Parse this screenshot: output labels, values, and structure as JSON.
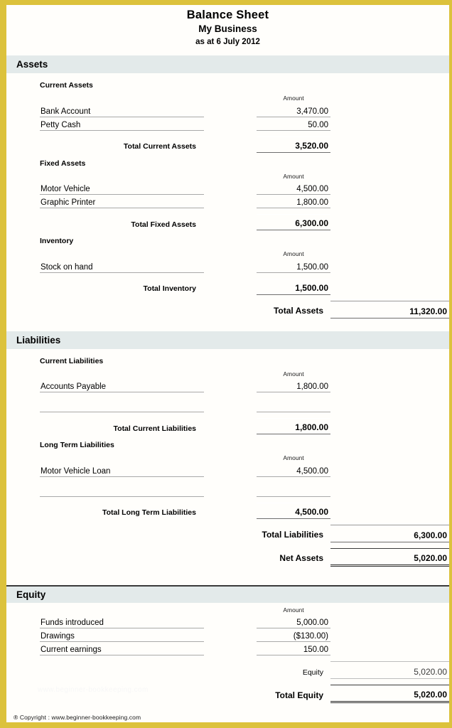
{
  "document": {
    "title": "Balance Sheet",
    "company": "My Business",
    "as_at": "as at 6 July 2012",
    "amount_header": "Amount",
    "accent_border_color": "#dcc23c",
    "section_bar_color": "#e3eaea"
  },
  "sections": {
    "assets": {
      "heading": "Assets",
      "groups": [
        {
          "title": "Current Assets",
          "items": [
            {
              "name": "Bank Account",
              "amount": "3,470.00"
            },
            {
              "name": "Petty Cash",
              "amount": "50.00"
            }
          ],
          "total_label": "Total Current Assets",
          "total_amount": "3,520.00"
        },
        {
          "title": "Fixed Assets",
          "items": [
            {
              "name": "Motor Vehicle",
              "amount": "4,500.00"
            },
            {
              "name": "Graphic Printer",
              "amount": "1,800.00"
            }
          ],
          "total_label": "Total Fixed Assets",
          "total_amount": "6,300.00"
        },
        {
          "title": "Inventory",
          "items": [
            {
              "name": "Stock on hand",
              "amount": "1,500.00"
            }
          ],
          "total_label": "Total Inventory",
          "total_amount": "1,500.00"
        }
      ],
      "grand_label": "Total Assets",
      "grand_amount": "11,320.00"
    },
    "liabilities": {
      "heading": "Liabilities",
      "groups": [
        {
          "title": "Current Liabilities",
          "items": [
            {
              "name": "Accounts Payable",
              "amount": "1,800.00"
            },
            {
              "name": "",
              "amount": ""
            }
          ],
          "total_label": "Total Current Liabilities",
          "total_amount": "1,800.00"
        },
        {
          "title": "Long Term Liabilities",
          "items": [
            {
              "name": "Motor Vehicle Loan",
              "amount": "4,500.00"
            },
            {
              "name": "",
              "amount": ""
            }
          ],
          "total_label": "Total Long Term Liabilities",
          "total_amount": "4,500.00"
        }
      ],
      "grand_label": "Total Liabilities",
      "grand_amount": "6,300.00",
      "net_label": "Net Assets",
      "net_amount": "5,020.00"
    },
    "equity": {
      "heading": "Equity",
      "items": [
        {
          "name": "Funds introduced",
          "amount": "5,000.00"
        },
        {
          "name": "Drawings",
          "amount": "($130.00)"
        },
        {
          "name": "Current earnings",
          "amount": "150.00"
        }
      ],
      "subtotal_label": "Equity",
      "subtotal_amount": "5,020.00",
      "grand_label": "Total Equity",
      "grand_amount": "5,020.00"
    }
  },
  "footer": {
    "watermark": "www.beginner-bookkeeping.com",
    "copyright": "® Copyright : www.beginner-bookkeeping.com"
  }
}
